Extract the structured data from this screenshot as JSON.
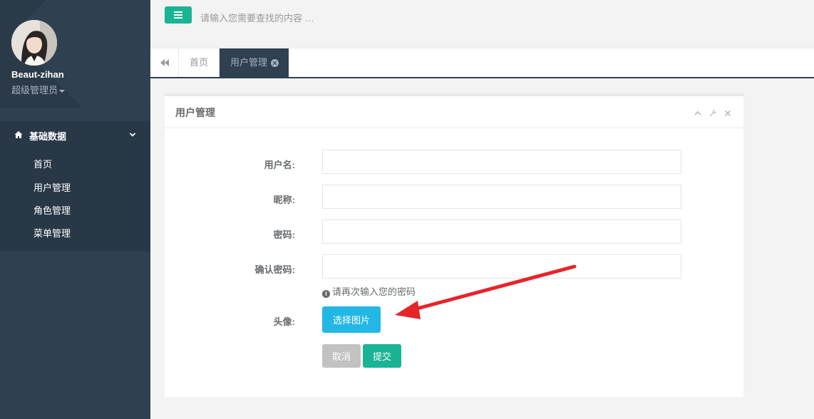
{
  "sidebar": {
    "user_name": "Beaut-zihan",
    "user_role": "超级管理员",
    "group_label": "基础数据",
    "items": [
      {
        "label": "首页"
      },
      {
        "label": "用户管理"
      },
      {
        "label": "角色管理"
      },
      {
        "label": "菜单管理"
      }
    ]
  },
  "topbar": {
    "menu_icon": "bars-icon",
    "search_placeholder": "请输入您需要查找的内容 …"
  },
  "tabs": {
    "back_icon": "backward-icon",
    "home_label": "首页",
    "active_label": "用户管理",
    "close_icon": "close-circle-icon"
  },
  "panel": {
    "title": "用户管理",
    "tools": [
      "chevron-up-icon",
      "wrench-icon",
      "close-icon"
    ]
  },
  "form": {
    "username_label": "用户名:",
    "username_value": "",
    "nickname_label": "昵称:",
    "nickname_value": "",
    "password_label": "密码:",
    "password_value": "",
    "confirm_label": "确认密码:",
    "confirm_value": "",
    "confirm_help": "请再次输入您的密码",
    "avatar_label": "头像:",
    "upload_button": "选择图片",
    "cancel_button": "取消",
    "submit_button": "提交"
  },
  "colors": {
    "sidebar": "#2f4050",
    "primary": "#1ab394",
    "info": "#23b7e5",
    "annotation_arrow": "#e5252a"
  }
}
